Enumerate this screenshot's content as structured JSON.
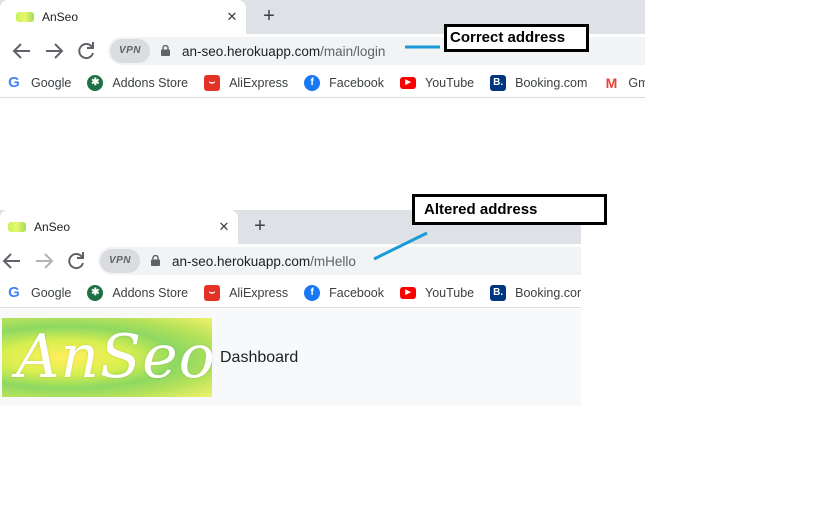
{
  "top": {
    "tab_title": "AnSeo",
    "close_glyph": "✕",
    "newtab_glyph": "+",
    "vpn_label": "VPN",
    "url_host": "an-seo.herokuapp.com",
    "url_path": "/main/login"
  },
  "bottom": {
    "tab_title": "AnSeo",
    "close_glyph": "✕",
    "newtab_glyph": "+",
    "vpn_label": "VPN",
    "url_host": "an-seo.herokuapp.com",
    "url_path": "/mHello",
    "logo_text": "AnSeo",
    "dashboard_label": "Dashboard"
  },
  "bookmarks": [
    {
      "label": "Google",
      "icon": "google-icon",
      "glyph": "G"
    },
    {
      "label": "Addons Store",
      "icon": "addons-store-icon",
      "glyph": "✱"
    },
    {
      "label": "AliExpress",
      "icon": "aliexpress-icon",
      "glyph": "⌣"
    },
    {
      "label": "Facebook",
      "icon": "facebook-icon",
      "glyph": "f"
    },
    {
      "label": "YouTube",
      "icon": "youtube-icon",
      "glyph": "▶"
    },
    {
      "label": "Booking.com",
      "icon": "booking-icon",
      "glyph": "B."
    },
    {
      "label": "Gmail",
      "icon": "gmail-icon",
      "glyph": "M"
    }
  ],
  "annotations": {
    "correct": "Correct address",
    "altered": "Altered address",
    "line_color": "#1a9ad6"
  }
}
